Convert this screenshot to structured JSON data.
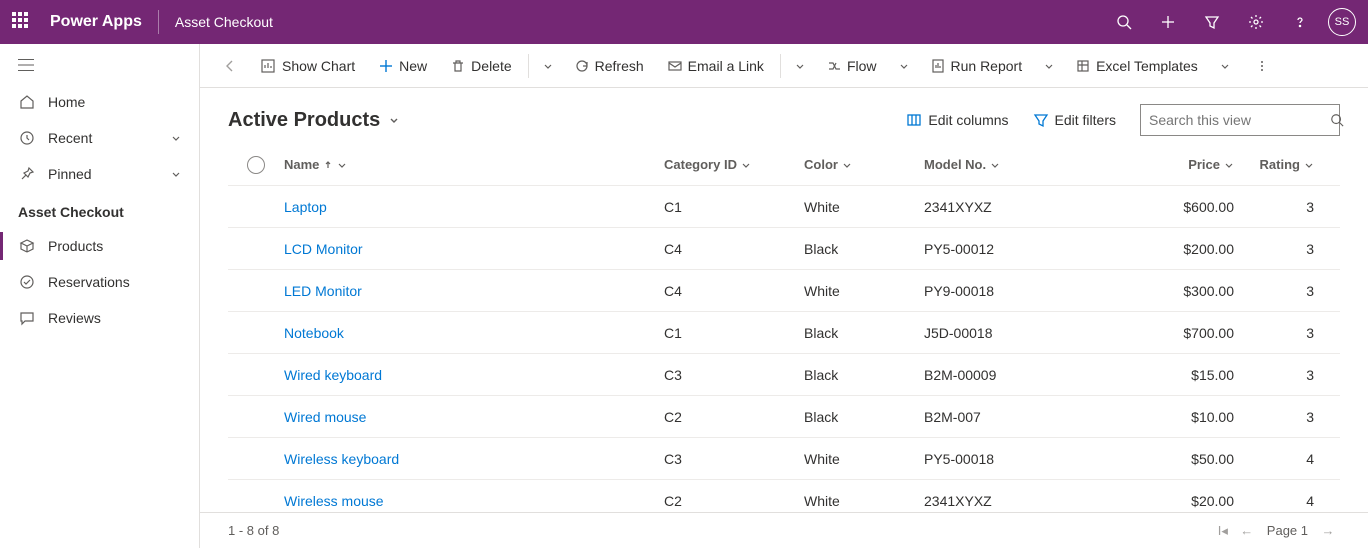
{
  "header": {
    "app_name": "Power Apps",
    "env_name": "Asset Checkout",
    "avatar": "SS"
  },
  "sidebar": {
    "home": "Home",
    "recent": "Recent",
    "pinned": "Pinned",
    "section": "Asset Checkout",
    "products": "Products",
    "reservations": "Reservations",
    "reviews": "Reviews"
  },
  "commands": {
    "show_chart": "Show Chart",
    "new": "New",
    "delete": "Delete",
    "refresh": "Refresh",
    "email_link": "Email a Link",
    "flow": "Flow",
    "run_report": "Run Report",
    "excel": "Excel Templates"
  },
  "view": {
    "title": "Active Products",
    "edit_columns": "Edit columns",
    "edit_filters": "Edit filters",
    "search_placeholder": "Search this view"
  },
  "columns": {
    "name": "Name",
    "category": "Category ID",
    "color": "Color",
    "model": "Model No.",
    "price": "Price",
    "rating": "Rating"
  },
  "rows": [
    {
      "name": "Laptop",
      "category": "C1",
      "color": "White",
      "model": "2341XYXZ",
      "price": "$600.00",
      "rating": "3"
    },
    {
      "name": "LCD Monitor",
      "category": "C4",
      "color": "Black",
      "model": "PY5-00012",
      "price": "$200.00",
      "rating": "3"
    },
    {
      "name": "LED Monitor",
      "category": "C4",
      "color": "White",
      "model": "PY9-00018",
      "price": "$300.00",
      "rating": "3"
    },
    {
      "name": "Notebook",
      "category": "C1",
      "color": "Black",
      "model": "J5D-00018",
      "price": "$700.00",
      "rating": "3"
    },
    {
      "name": "Wired keyboard",
      "category": "C3",
      "color": "Black",
      "model": "B2M-00009",
      "price": "$15.00",
      "rating": "3"
    },
    {
      "name": "Wired mouse",
      "category": "C2",
      "color": "Black",
      "model": "B2M-007",
      "price": "$10.00",
      "rating": "3"
    },
    {
      "name": "Wireless keyboard",
      "category": "C3",
      "color": "White",
      "model": "PY5-00018",
      "price": "$50.00",
      "rating": "4"
    },
    {
      "name": "Wireless mouse",
      "category": "C2",
      "color": "White",
      "model": "2341XYXZ",
      "price": "$20.00",
      "rating": "4"
    }
  ],
  "footer": {
    "count": "1 - 8 of 8",
    "page": "Page 1"
  }
}
